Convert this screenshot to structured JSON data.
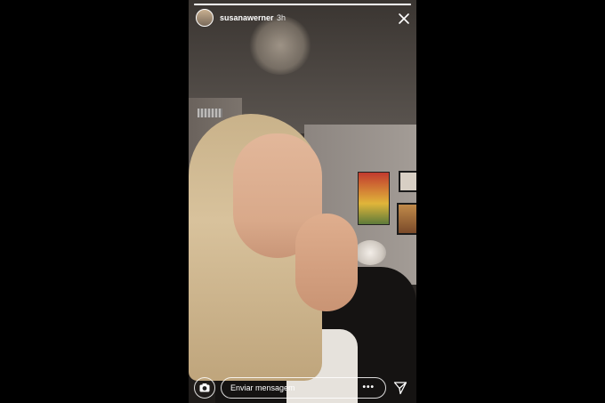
{
  "story": {
    "username": "susanawerner",
    "time_ago": "3h",
    "progress": 1.0
  },
  "footer": {
    "message_placeholder": "Enviar mensagem",
    "more_label": "•••"
  },
  "icons": {
    "close": "close-icon",
    "camera": "camera-icon",
    "send": "send-icon",
    "more": "more-options-icon"
  }
}
